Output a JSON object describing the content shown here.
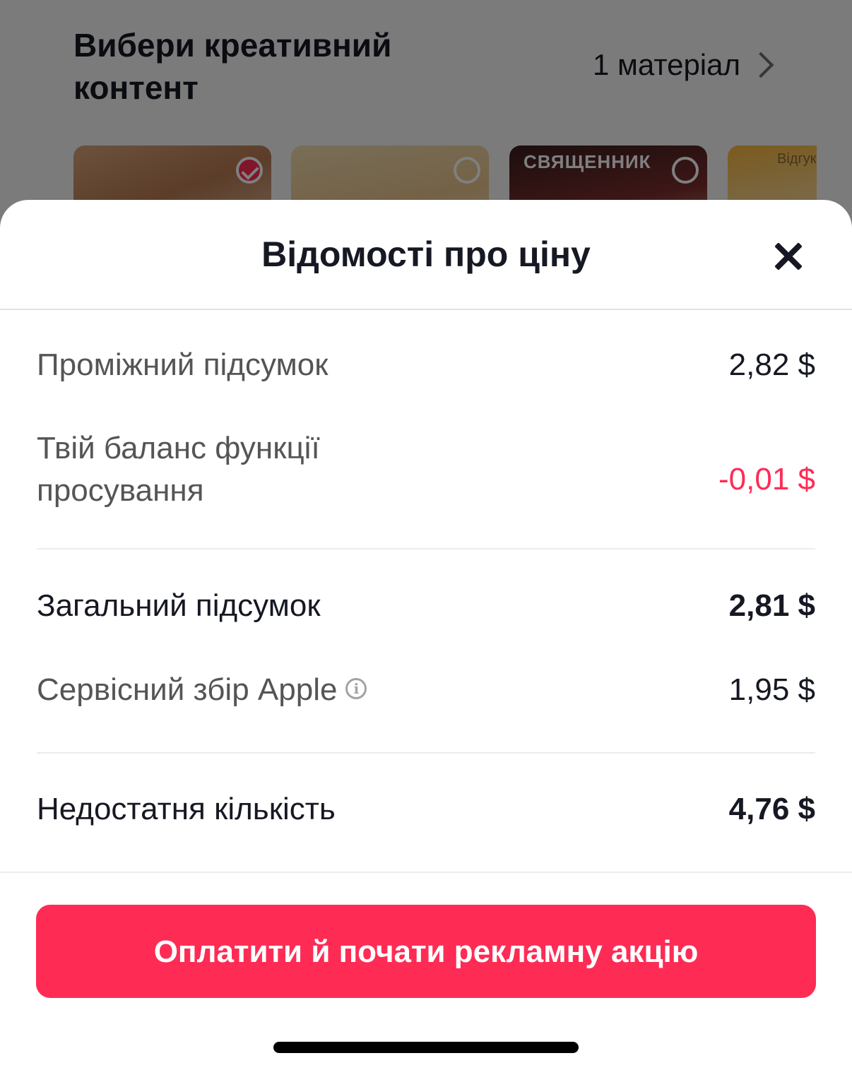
{
  "background": {
    "title": "Вибери креативний контент",
    "material_count": "1 матеріал",
    "thumbnails": [
      {
        "caption": "",
        "selected": true
      },
      {
        "caption": "",
        "selected": false
      },
      {
        "caption": "СВЯЩЕННИК",
        "selected": false
      },
      {
        "caption": "Відгук",
        "selected": false
      }
    ]
  },
  "sheet": {
    "title": "Відомості про ціну",
    "rows": {
      "subtotal": {
        "label": "Проміжний підсумок",
        "value": "2,82 $"
      },
      "balance": {
        "label": "Твій баланс функції просування",
        "value": "-0,01 $"
      },
      "total": {
        "label": "Загальний підсумок",
        "value": "2,81 $"
      },
      "apple_fee": {
        "label": "Сервісний збір Apple",
        "value": "1,95 $"
      },
      "insufficient": {
        "label": "Недостатня кількість",
        "value": "4,76 $"
      }
    },
    "pay_button_label": "Оплатити й почати рекламну акцію"
  },
  "colors": {
    "accent": "#fe2c55",
    "text_primary": "#161823",
    "text_secondary": "#545556"
  },
  "icons": {
    "close": "close-icon",
    "info": "info-icon",
    "chevron": "chevron-right-icon"
  }
}
